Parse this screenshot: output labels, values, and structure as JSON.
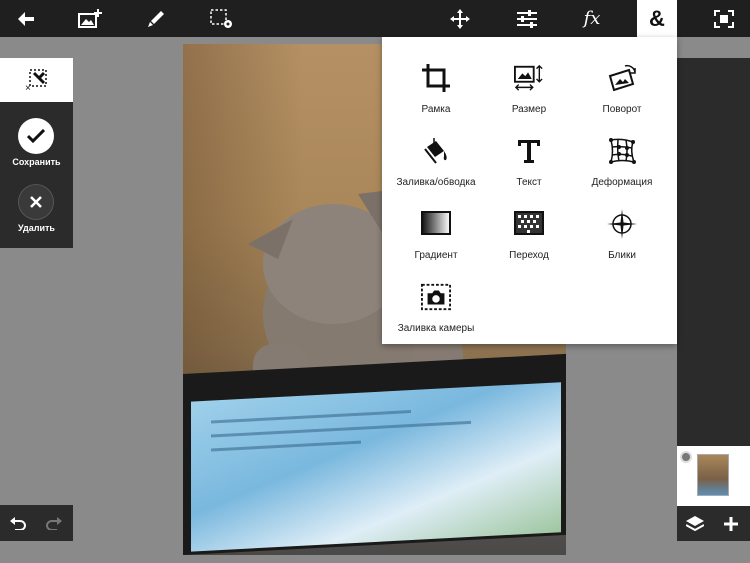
{
  "topbar": {
    "back": "back-arrow-icon",
    "add_image": "add-image-icon",
    "brush": "brush-icon",
    "selection": "selection-gear-icon",
    "move": "move-icon",
    "adjust": "sliders-icon",
    "fx_label": "fx",
    "amp_label": "&",
    "fullscreen": "fullscreen-icon"
  },
  "left": {
    "save_label": "Сохранить",
    "delete_label": "Удалить"
  },
  "menu": {
    "items": [
      {
        "label": "Рамка",
        "icon": "crop-icon"
      },
      {
        "label": "Размер",
        "icon": "resize-icon"
      },
      {
        "label": "Поворот",
        "icon": "rotate-icon"
      },
      {
        "label": "Заливка/обводка",
        "icon": "fill-stroke-icon"
      },
      {
        "label": "Текст",
        "icon": "text-icon"
      },
      {
        "label": "Деформация",
        "icon": "warp-icon"
      },
      {
        "label": "Градиент",
        "icon": "gradient-icon"
      },
      {
        "label": "Переход",
        "icon": "transition-icon"
      },
      {
        "label": "Блики",
        "icon": "flare-icon"
      },
      {
        "label": "Заливка камеры",
        "icon": "camera-fill-icon"
      }
    ]
  },
  "colors": {
    "bar": "#1f1f1f",
    "panel": "#2b2b2b",
    "canvas": "#8a8a8a",
    "active": "#ffffff"
  }
}
